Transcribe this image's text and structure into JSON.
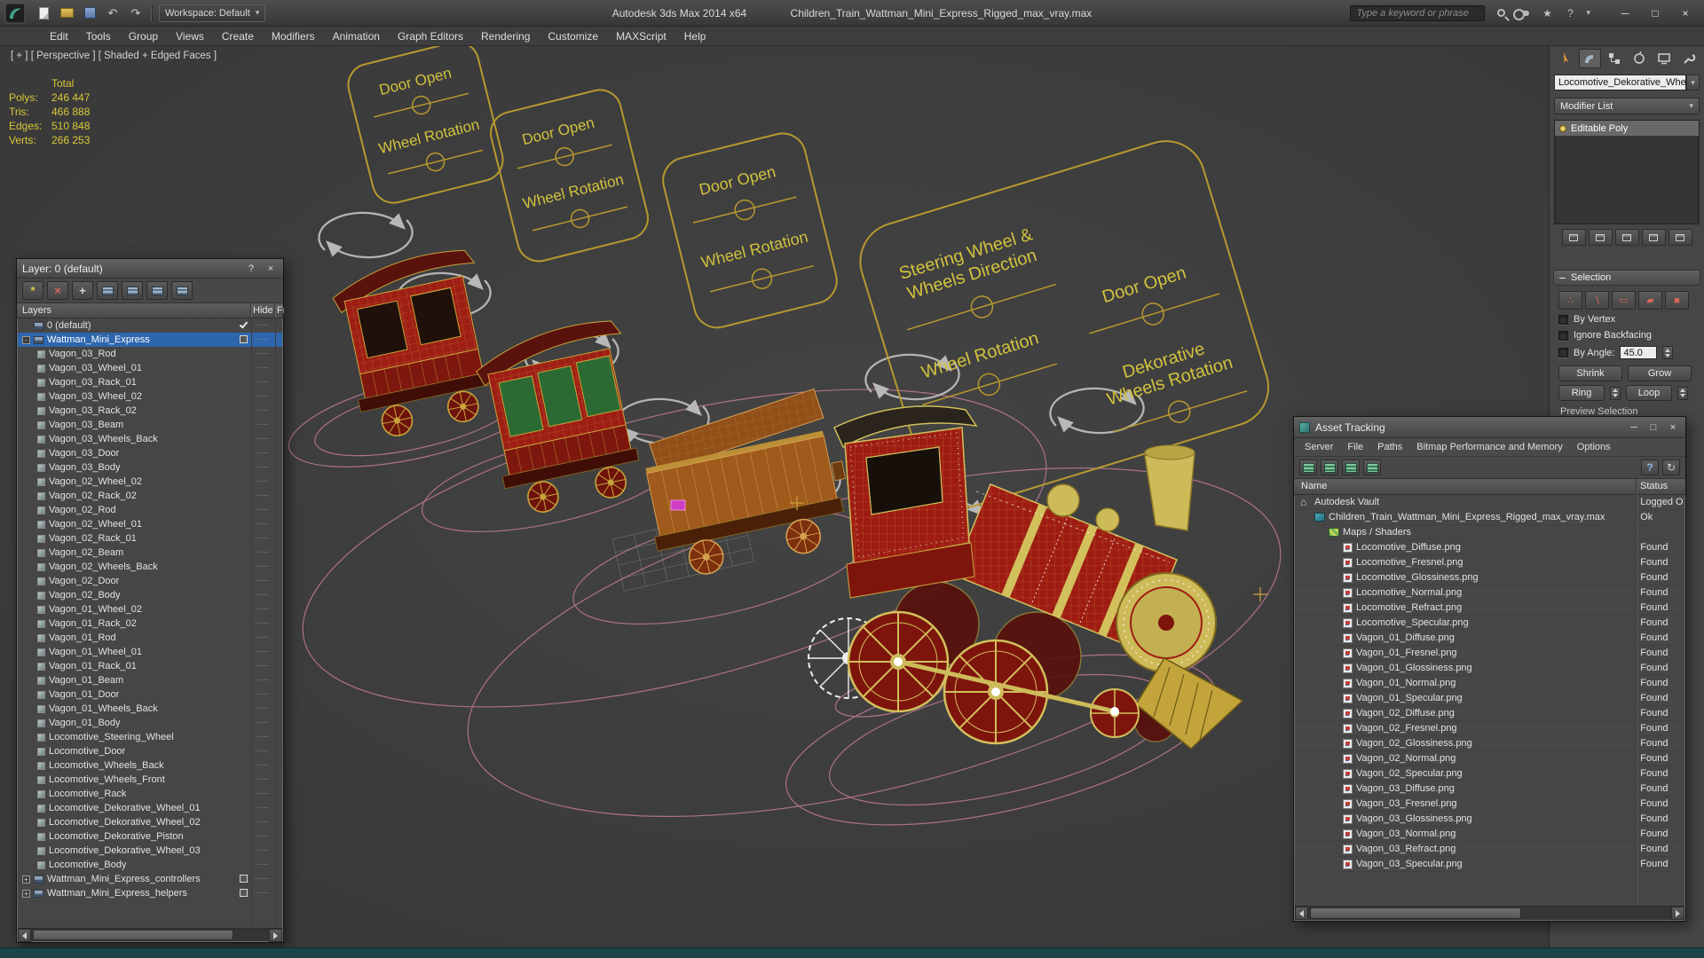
{
  "window": {
    "app_title": "Autodesk 3ds Max 2014 x64",
    "doc_title": "Children_Train_Wattman_Mini_Express_Rigged_max_vray.max",
    "workspace_label": "Workspace: Default",
    "search_placeholder": "Type a keyword or phrase"
  },
  "icons": {
    "dropdown": "▾",
    "minimize": "─",
    "maximize": "□",
    "close": "×",
    "question": "?",
    "undo": "↶",
    "redo": "↷",
    "star": "★",
    "refresh": "↻",
    "asterisk": "*",
    "plus": "+",
    "vertex": "∴",
    "edge": "∖",
    "border": "▭",
    "polygon": "▰",
    "element": "■"
  },
  "menubar": {
    "items": [
      "Edit",
      "Tools",
      "Group",
      "Views",
      "Create",
      "Modifiers",
      "Animation",
      "Graph Editors",
      "Rendering",
      "Customize",
      "MAXScript",
      "Help"
    ]
  },
  "viewport": {
    "label": "[ + ] [ Perspective ] [ Shaded + Edged Faces ]",
    "stats": {
      "header": "Total",
      "rows": [
        {
          "label": "Polys:",
          "value": "246 447"
        },
        {
          "label": "Tris:",
          "value": "466 888"
        },
        {
          "label": "Edges:",
          "value": "510 848"
        },
        {
          "label": "Verts:",
          "value": "266 253"
        }
      ]
    },
    "callouts": {
      "c1": {
        "l1": "Door Open",
        "l2": "Wheel Rotation"
      },
      "c2": {
        "l1": "Door Open",
        "l2": "Wheel Rotation"
      },
      "c3": {
        "l1": "Door Open",
        "l2": "Wheel Rotation"
      },
      "big": {
        "l1a": "Steering Wheel &",
        "l1b": "Wheels Direction",
        "l2": "Wheel Rotation",
        "l3": "Door Open",
        "l4a": "Dekorative",
        "l4b": "Wheels  Rotation"
      }
    },
    "accent_colors": {
      "wireframe_yellow": "#d2c05c",
      "stats_yellow": "#d9c838",
      "motion_path_pink": "#c97f9c",
      "selection_blue": "#2e66ad"
    }
  },
  "layer_window": {
    "title": "Layer: 0 (default)",
    "columns": [
      "Layers",
      "Hide",
      "Fr"
    ],
    "rows": [
      {
        "label": "0 (default)",
        "level": 0,
        "kind": "layer",
        "current": true
      },
      {
        "label": "Wattman_Mini_Express",
        "level": 0,
        "kind": "layer",
        "expander": "-",
        "selected": true,
        "box": true
      },
      {
        "label": "Vagon_03_Rod",
        "level": 1,
        "kind": "object"
      },
      {
        "label": "Vagon_03_Wheel_01",
        "level": 1,
        "kind": "object"
      },
      {
        "label": "Vagon_03_Rack_01",
        "level": 1,
        "kind": "object"
      },
      {
        "label": "Vagon_03_Wheel_02",
        "level": 1,
        "kind": "object"
      },
      {
        "label": "Vagon_03_Rack_02",
        "level": 1,
        "kind": "object"
      },
      {
        "label": "Vagon_03_Beam",
        "level": 1,
        "kind": "object"
      },
      {
        "label": "Vagon_03_Wheels_Back",
        "level": 1,
        "kind": "object"
      },
      {
        "label": "Vagon_03_Door",
        "level": 1,
        "kind": "object"
      },
      {
        "label": "Vagon_03_Body",
        "level": 1,
        "kind": "object"
      },
      {
        "label": "Vagon_02_Wheel_02",
        "level": 1,
        "kind": "object"
      },
      {
        "label": "Vagon_02_Rack_02",
        "level": 1,
        "kind": "object"
      },
      {
        "label": "Vagon_02_Rod",
        "level": 1,
        "kind": "object"
      },
      {
        "label": "Vagon_02_Wheel_01",
        "level": 1,
        "kind": "object"
      },
      {
        "label": "Vagon_02_Rack_01",
        "level": 1,
        "kind": "object"
      },
      {
        "label": "Vagon_02_Beam",
        "level": 1,
        "kind": "object"
      },
      {
        "label": "Vagon_02_Wheels_Back",
        "level": 1,
        "kind": "object"
      },
      {
        "label": "Vagon_02_Door",
        "level": 1,
        "kind": "object"
      },
      {
        "label": "Vagon_02_Body",
        "level": 1,
        "kind": "object"
      },
      {
        "label": "Vagon_01_Wheel_02",
        "level": 1,
        "kind": "object"
      },
      {
        "label": "Vagon_01_Rack_02",
        "level": 1,
        "kind": "object"
      },
      {
        "label": "Vagon_01_Rod",
        "level": 1,
        "kind": "object"
      },
      {
        "label": "Vagon_01_Wheel_01",
        "level": 1,
        "kind": "object"
      },
      {
        "label": "Vagon_01_Rack_01",
        "level": 1,
        "kind": "object"
      },
      {
        "label": "Vagon_01_Beam",
        "level": 1,
        "kind": "object"
      },
      {
        "label": "Vagon_01_Door",
        "level": 1,
        "kind": "object"
      },
      {
        "label": "Vagon_01_Wheels_Back",
        "level": 1,
        "kind": "object"
      },
      {
        "label": "Vagon_01_Body",
        "level": 1,
        "kind": "object"
      },
      {
        "label": "Locomotive_Steering_Wheel",
        "level": 1,
        "kind": "object"
      },
      {
        "label": "Locomotive_Door",
        "level": 1,
        "kind": "object"
      },
      {
        "label": "Locomotive_Wheels_Back",
        "level": 1,
        "kind": "object"
      },
      {
        "label": "Locomotive_Wheels_Front",
        "level": 1,
        "kind": "object"
      },
      {
        "label": "Locomotive_Rack",
        "level": 1,
        "kind": "object"
      },
      {
        "label": "Locomotive_Dekorative_Wheel_01",
        "level": 1,
        "kind": "object"
      },
      {
        "label": "Locomotive_Dekorative_Wheel_02",
        "level": 1,
        "kind": "object"
      },
      {
        "label": "Locomotive_Dekorative_Piston",
        "level": 1,
        "kind": "object"
      },
      {
        "label": "Locomotive_Dekorative_Wheel_03",
        "level": 1,
        "kind": "object"
      },
      {
        "label": "Locomotive_Body",
        "level": 1,
        "kind": "object"
      },
      {
        "label": "Wattman_Mini_Express_controllers",
        "level": 0,
        "kind": "layer",
        "expander": "+",
        "box": true
      },
      {
        "label": "Wattman_Mini_Express_helpers",
        "level": 0,
        "kind": "layer",
        "expander": "+",
        "box": true
      }
    ]
  },
  "asset_window": {
    "title": "Asset Tracking",
    "menu": [
      "Server",
      "File",
      "Paths",
      "Bitmap Performance and Memory",
      "Options"
    ],
    "columns": [
      "Name",
      "Status"
    ],
    "rows": [
      {
        "name": "Autodesk Vault",
        "status": "Logged O",
        "level": 0,
        "icon": "vault"
      },
      {
        "name": "Children_Train_Wattman_Mini_Express_Rigged_max_vray.max",
        "status": "Ok",
        "level": 1,
        "icon": "max"
      },
      {
        "name": "Maps / Shaders",
        "status": "",
        "level": 2,
        "icon": "maps"
      },
      {
        "name": "Locomotive_Diffuse.png",
        "status": "Found",
        "level": 3,
        "icon": "png"
      },
      {
        "name": "Locomotive_Fresnel.png",
        "status": "Found",
        "level": 3,
        "icon": "png"
      },
      {
        "name": "Locomotive_Glossiness.png",
        "status": "Found",
        "level": 3,
        "icon": "png"
      },
      {
        "name": "Locomotive_Normal.png",
        "status": "Found",
        "level": 3,
        "icon": "png"
      },
      {
        "name": "Locomotive_Refract.png",
        "status": "Found",
        "level": 3,
        "icon": "png"
      },
      {
        "name": "Locomotive_Specular.png",
        "status": "Found",
        "level": 3,
        "icon": "png"
      },
      {
        "name": "Vagon_01_Diffuse.png",
        "status": "Found",
        "level": 3,
        "icon": "png"
      },
      {
        "name": "Vagon_01_Fresnel.png",
        "status": "Found",
        "level": 3,
        "icon": "png"
      },
      {
        "name": "Vagon_01_Glossiness.png",
        "status": "Found",
        "level": 3,
        "icon": "png"
      },
      {
        "name": "Vagon_01_Normal.png",
        "status": "Found",
        "level": 3,
        "icon": "png"
      },
      {
        "name": "Vagon_01_Specular.png",
        "status": "Found",
        "level": 3,
        "icon": "png"
      },
      {
        "name": "Vagon_02_Diffuse.png",
        "status": "Found",
        "level": 3,
        "icon": "png"
      },
      {
        "name": "Vagon_02_Fresnel.png",
        "status": "Found",
        "level": 3,
        "icon": "png"
      },
      {
        "name": "Vagon_02_Glossiness.png",
        "status": "Found",
        "level": 3,
        "icon": "png"
      },
      {
        "name": "Vagon_02_Normal.png",
        "status": "Found",
        "level": 3,
        "icon": "png"
      },
      {
        "name": "Vagon_02_Specular.png",
        "status": "Found",
        "level": 3,
        "icon": "png"
      },
      {
        "name": "Vagon_03_Diffuse.png",
        "status": "Found",
        "level": 3,
        "icon": "png"
      },
      {
        "name": "Vagon_03_Fresnel.png",
        "status": "Found",
        "level": 3,
        "icon": "png"
      },
      {
        "name": "Vagon_03_Glossiness.png",
        "status": "Found",
        "level": 3,
        "icon": "png"
      },
      {
        "name": "Vagon_03_Normal.png",
        "status": "Found",
        "level": 3,
        "icon": "png"
      },
      {
        "name": "Vagon_03_Refract.png",
        "status": "Found",
        "level": 3,
        "icon": "png"
      },
      {
        "name": "Vagon_03_Specular.png",
        "status": "Found",
        "level": 3,
        "icon": "png"
      }
    ]
  },
  "command_panel": {
    "object_name": "Locomotive_Dekorative_Whe",
    "modifier_list_label": "Modifier List",
    "stack_items": [
      "Editable Poly"
    ],
    "selection": {
      "title": "Selection",
      "by_vertex": "By Vertex",
      "ignore_backfacing": "Ignore Backfacing",
      "by_angle": "By Angle:",
      "angle_value": "45.0",
      "shrink": "Shrink",
      "grow": "Grow",
      "ring": "Ring",
      "loop": "Loop",
      "preview": "Preview Selection"
    }
  }
}
